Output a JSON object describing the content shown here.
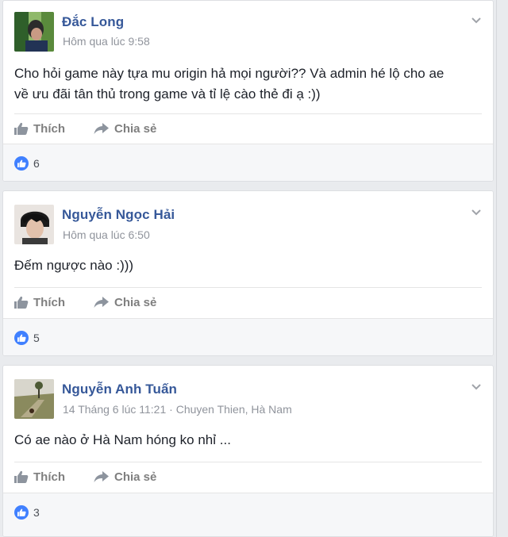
{
  "posts": [
    {
      "author": "Đắc Long",
      "time": "Hôm qua lúc 9:58",
      "location": "",
      "text_line1": "Cho hỏi game này tựa mu origin hả mọi người?? Và admin hé lộ cho ae",
      "text_line2": "về ưu đãi tân thủ trong game và tỉ lệ cào thẻ đi ạ :))",
      "like_label": "Thích",
      "share_label": "Chia sẻ",
      "like_count": "6"
    },
    {
      "author": "Nguyễn Ngọc Hải",
      "time": "Hôm qua lúc 6:50",
      "location": "",
      "text_line1": "Đếm ngược nào :)))",
      "text_line2": "",
      "like_label": "Thích",
      "share_label": "Chia sẻ",
      "like_count": "5"
    },
    {
      "author": "Nguyễn Anh Tuấn",
      "time": "14 Tháng 6 lúc 11:21",
      "location": " · Chuyen Thien, Hà Nam",
      "text_line1": "Có ae nào ở Hà Nam hóng ko nhỉ ...",
      "text_line2": "",
      "like_label": "Thích",
      "share_label": "Chia sẻ",
      "like_count": "3"
    }
  ],
  "icons": {
    "like": "thumbs-up-icon",
    "share": "share-arrow-icon",
    "menu": "chevron-down-icon"
  },
  "colors": {
    "name": "#365899",
    "meta": "#90949c",
    "like_badge": "#4080ff",
    "background": "#e9ebee"
  }
}
